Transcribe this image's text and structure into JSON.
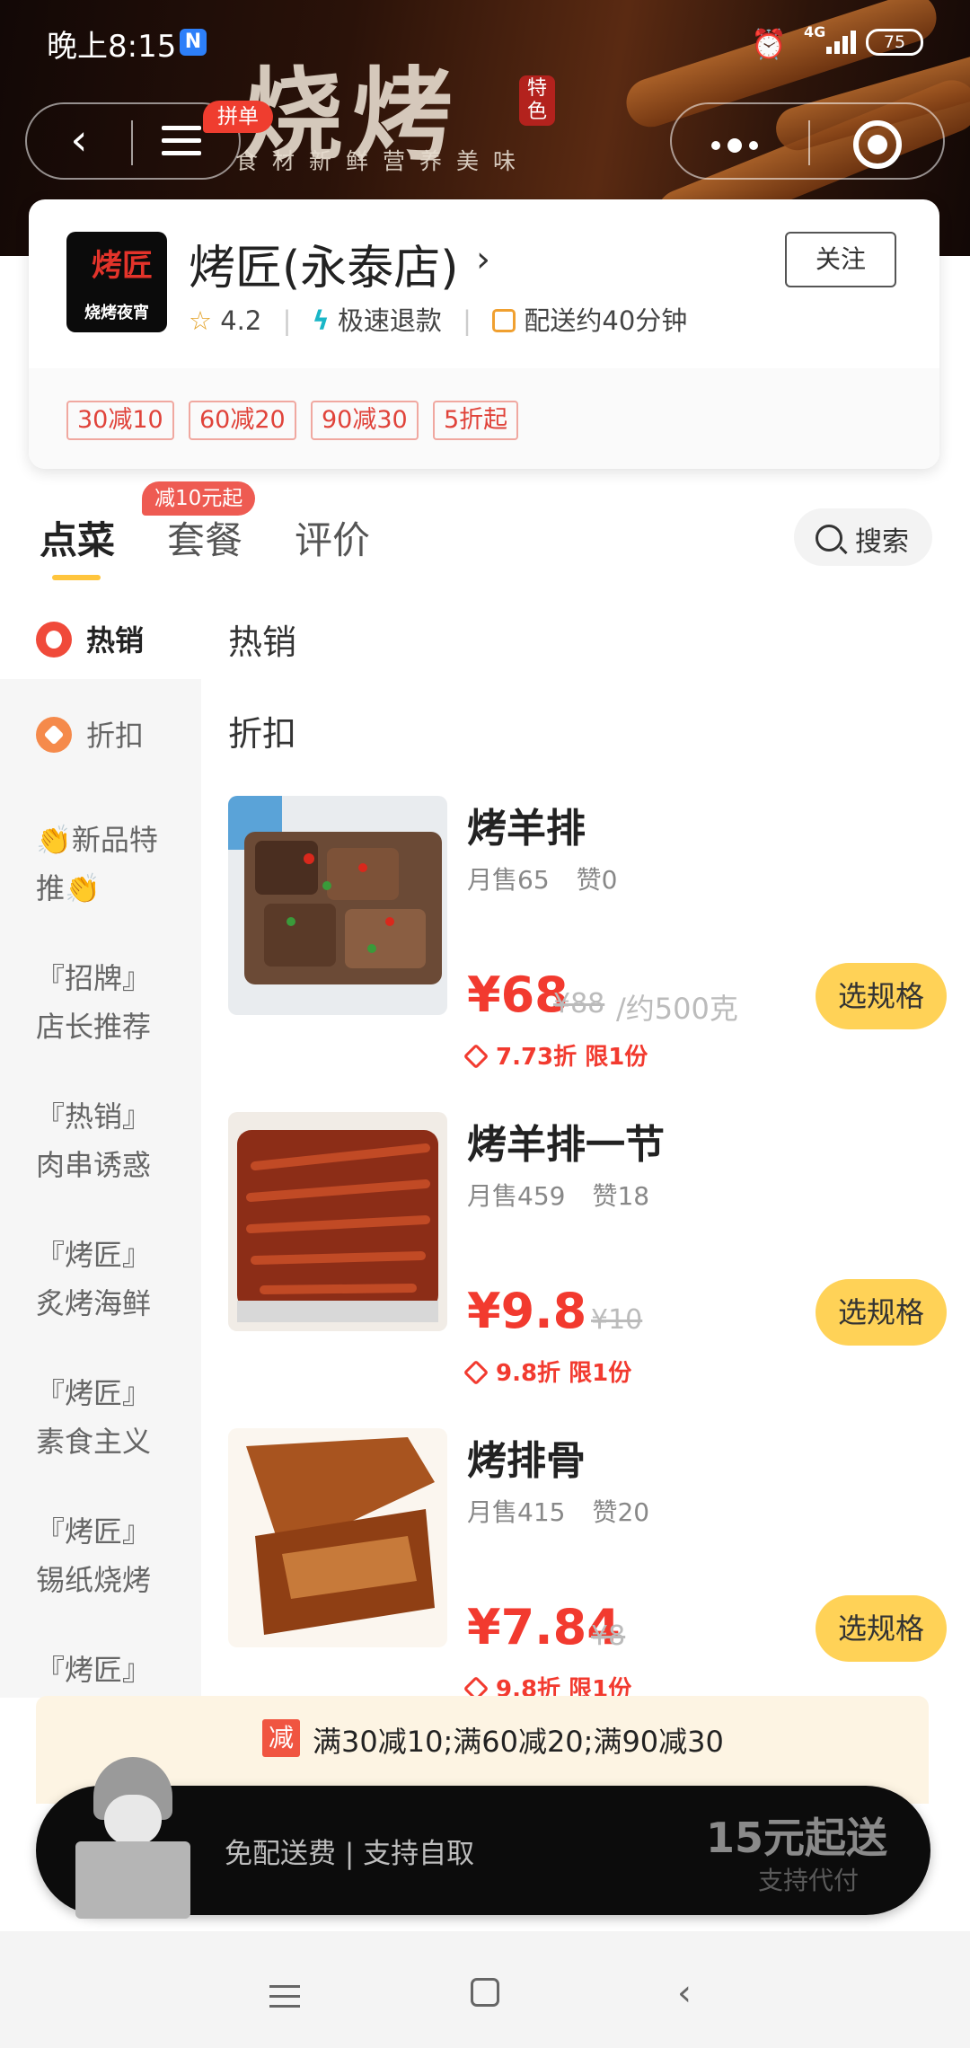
{
  "status_bar": {
    "time": "晚上8:15",
    "app_badge": "N",
    "network": "4G",
    "battery": "75"
  },
  "banner": {
    "title": "烧烤",
    "seal": "特色",
    "subtitle": "食材新鲜营养美味"
  },
  "nav": {
    "pindan_badge": "拼单"
  },
  "shop": {
    "name": "烤匠(永泰店)",
    "logo_main": "烤匠",
    "logo_sub": "烧烤夜宵",
    "follow_label": "关注",
    "rating": "4.2",
    "refund": "极速退款",
    "delivery": "配送约40分钟",
    "promo_tags": [
      "30减10",
      "60减20",
      "90减30",
      "5折起"
    ]
  },
  "tabs": {
    "items": [
      "点菜",
      "套餐",
      "评价"
    ],
    "active": "点菜",
    "badge": "减10元起",
    "search_label": "搜索"
  },
  "sidebar": {
    "items": [
      {
        "label": "热销"
      },
      {
        "label": "折扣"
      },
      {
        "label": "👏新品特推👏"
      },
      {
        "label": "『招牌』店长推荐"
      },
      {
        "label": "『热销』肉串诱惑"
      },
      {
        "label": "『烤匠』炙烤海鲜"
      },
      {
        "label": "『烤匠』素食主义"
      },
      {
        "label": "『烤匠』锡纸烧烤"
      },
      {
        "label": "『烤匠』爆款套餐"
      }
    ]
  },
  "sections": {
    "hot": "热销",
    "discount": "折扣"
  },
  "dishes": [
    {
      "name": "烤羊排",
      "monthly_sales": "月售65",
      "likes": "赞0",
      "price": "¥68",
      "orig_price": "¥88",
      "unit": "/约500克",
      "discount": "7.73折 限1份",
      "button": "选规格"
    },
    {
      "name": "烤羊排一节",
      "monthly_sales": "月售459",
      "likes": "赞18",
      "price": "¥9.8",
      "orig_price": "¥10",
      "unit": "",
      "discount": "9.8折 限1份",
      "button": "选规格"
    },
    {
      "name": "烤排骨",
      "monthly_sales": "月售415",
      "likes": "赞20",
      "price": "¥7.84",
      "orig_price": "¥8",
      "unit": "",
      "discount": "9.8折 限1份",
      "button": "选规格"
    }
  ],
  "promo_bar": {
    "icon": "减",
    "text": "满30减10;满60减20;满90减30"
  },
  "cart": {
    "delivery_text": "免配送费 | 支持自取",
    "min_order": "15元起送",
    "sub": "支持代付"
  },
  "colors": {
    "accent": "#ffd257",
    "price": "#f23a2f",
    "tag": "#e0433a"
  }
}
